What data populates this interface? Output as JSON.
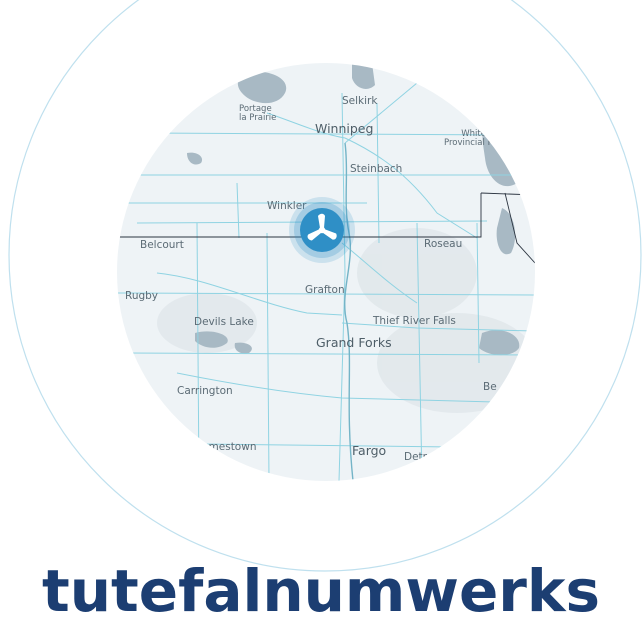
{
  "map": {
    "places": {
      "portage": "Portage\nla Prairie",
      "selkirk": "Selkirk",
      "winnipeg": "Winnipeg",
      "whiteshell": "Whiteshe\nProvincial Par",
      "steinbach": "Steinbach",
      "winkler": "Winkler",
      "belcourt": "Belcourt",
      "roseau": "Roseau",
      "rugby": "Rugby",
      "grafton": "Grafton",
      "devils_lake": "Devils Lake",
      "thief_river_falls": "Thief River Falls",
      "grand_forks": "Grand Forks",
      "carrington": "Carrington",
      "be": "Be",
      "jamestown": "Jamestown",
      "fargo": "Fargo",
      "detroit": "Detr"
    },
    "marker_icon": "wind-turbine-icon"
  },
  "headline": "tutefalnumwerks",
  "colors": {
    "ring": "#bfe0ee",
    "map_bg": "#eef3f6",
    "water": "#9fb1bd",
    "roads": "#8fd3e2",
    "border": "#2b3440",
    "marker": "#2f8fc6",
    "headline": "#1c3e72"
  }
}
